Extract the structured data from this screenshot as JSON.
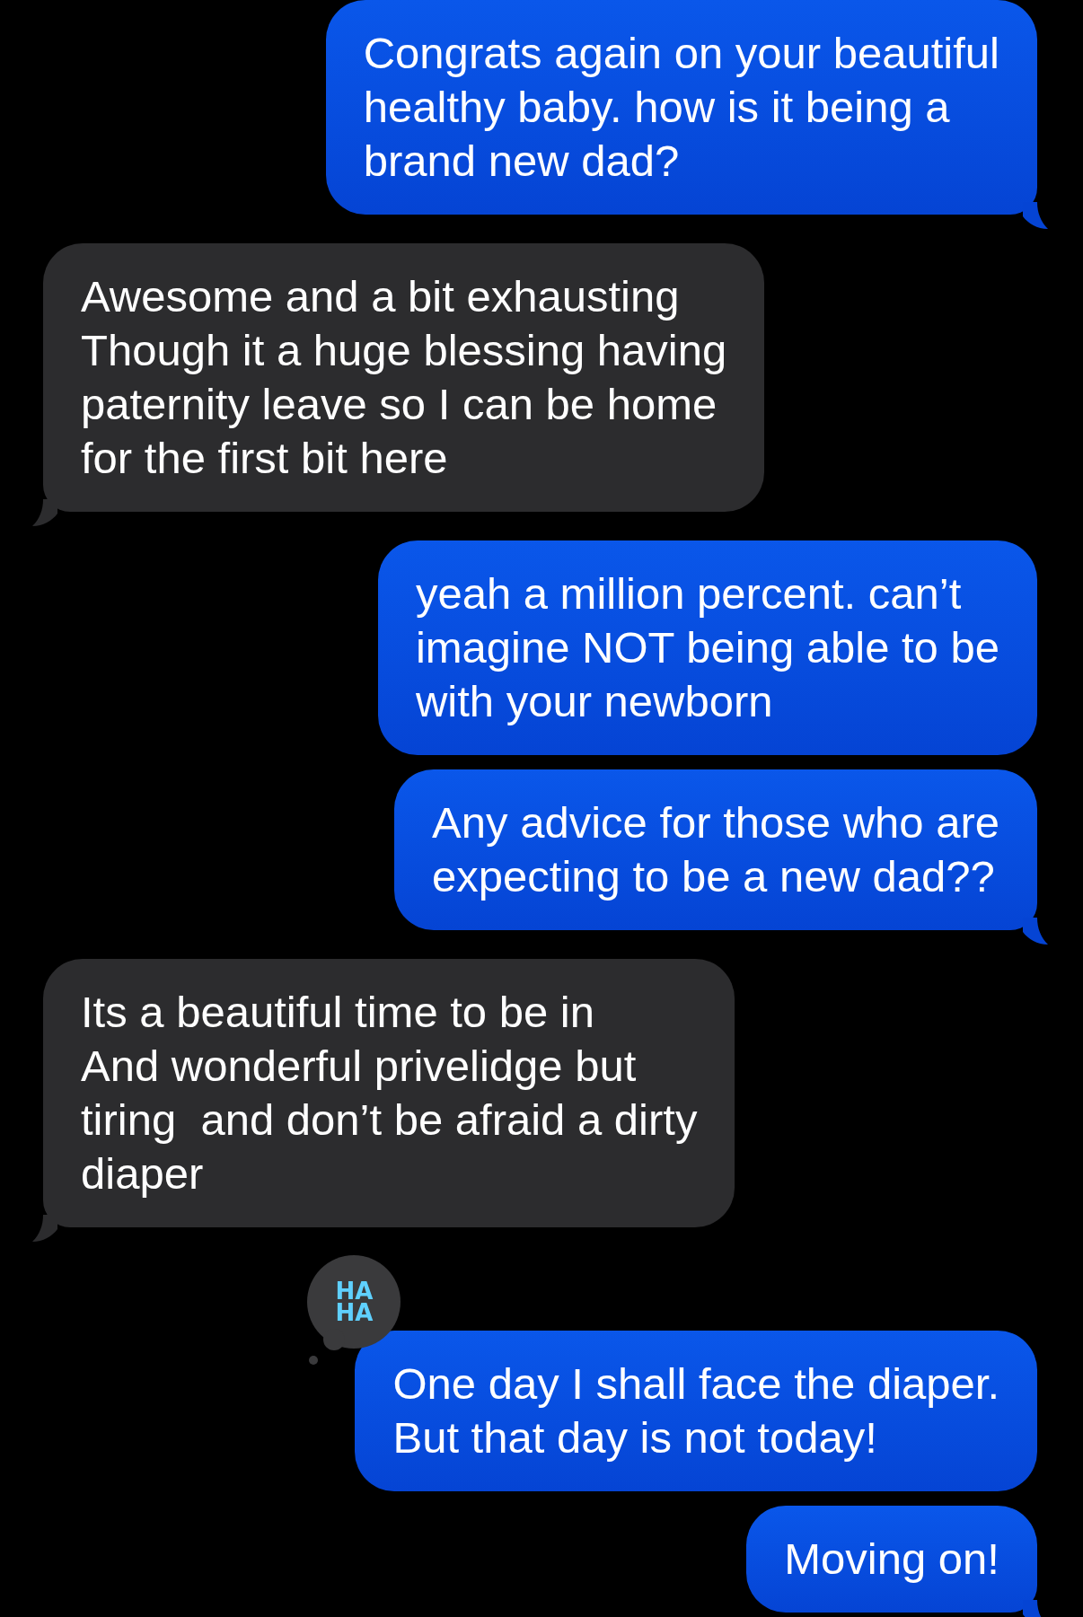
{
  "messages": [
    {
      "kind": "sent",
      "text": "Congrats again on your beautiful\nhealthy baby. how is it being a\nbrand new dad?",
      "tail": true
    },
    {
      "kind": "received",
      "text": "Awesome and a bit exhausting\nThough it a huge blessing having\npaternity leave so I can be home\nfor the first bit here",
      "tail": true
    },
    {
      "kind": "sent",
      "text": "yeah a million percent. can’t\nimagine NOT being able to be\nwith your newborn",
      "tail": false
    },
    {
      "kind": "sent",
      "text": "Any advice for those who are\nexpecting to be a new dad??",
      "tail": true
    },
    {
      "kind": "received",
      "text": "Its a beautiful time to be in\nAnd wonderful privelidge but\ntiring  and don’t be afraid a dirty\ndiaper",
      "tail": true
    },
    {
      "kind": "sent",
      "text": "One day I shall face the diaper.\nBut that day is not today!",
      "tail": false,
      "reaction": {
        "top": "HA",
        "bottom": "HA"
      }
    },
    {
      "kind": "sent",
      "text": "Moving on!",
      "tail": true
    }
  ]
}
